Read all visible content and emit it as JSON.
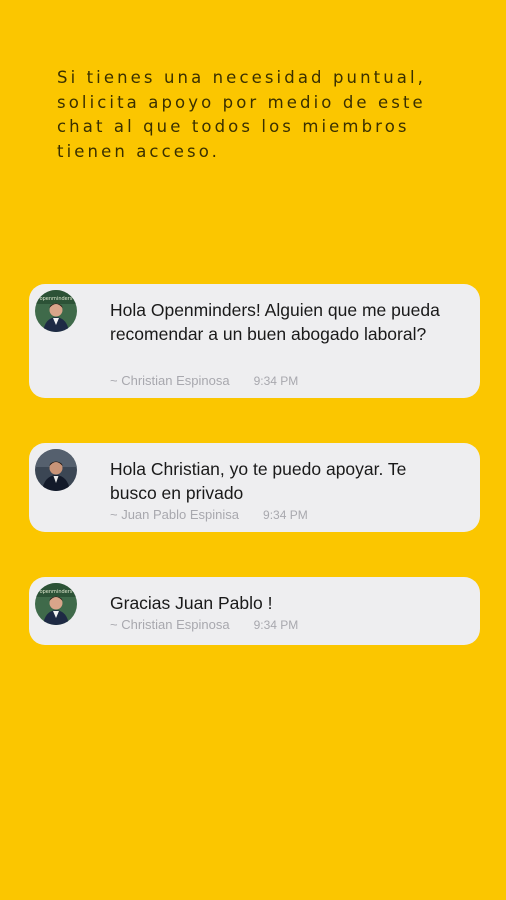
{
  "intro": {
    "text": "Si tienes una necesidad puntual, solicita apoyo por medio de este chat al que todos los miembros tienen acceso."
  },
  "messages": [
    {
      "text": "Hola Openminders! Alguien que me pueda recomendar a un buen abogado laboral?",
      "author": "~ Christian Espinosa",
      "time": "9:34 PM",
      "avatar_icon": "user-avatar-icon"
    },
    {
      "text": "Hola Christian, yo te puedo apoyar. Te busco en privado",
      "author": "~ Juan Pablo Espinisa",
      "time": "9:34 PM",
      "avatar_icon": "user-avatar-icon"
    },
    {
      "text": "Gracias Juan Pablo !",
      "author": "~ Christian Espinosa",
      "time": "9:34 PM",
      "avatar_icon": "user-avatar-icon"
    }
  ],
  "colors": {
    "background": "#FBC600",
    "bubble": "#EEEEF0",
    "meta_text": "#a8a8ae"
  }
}
